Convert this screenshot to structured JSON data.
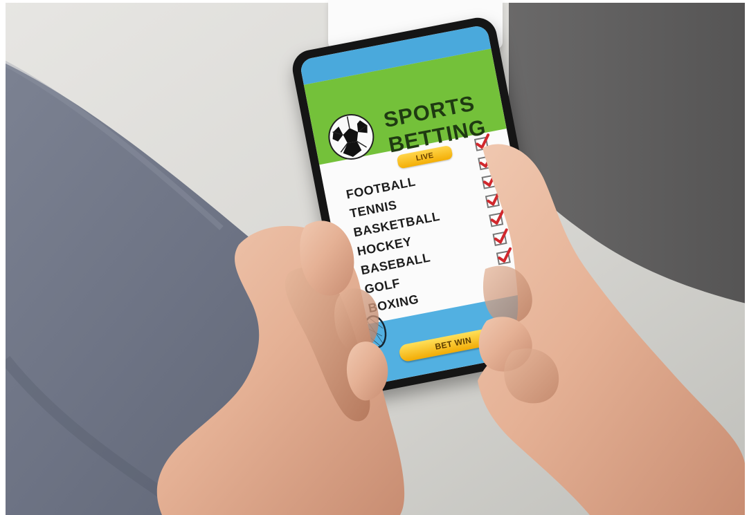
{
  "app": {
    "title_line_1": "SPORTS",
    "title_line_2": "BETTING",
    "live_label": "LIVE",
    "sports": [
      "FOOTBALL",
      "TENNIS",
      "BASKETBALL",
      "HOCKEY",
      "BASEBALL",
      "GOLF",
      "BOXING"
    ],
    "checked_count": 7,
    "bet_button_label": "BET WIN"
  },
  "icons": {
    "ball": "soccer-ball-icon",
    "check": "checkmark-icon",
    "racket": "tennis-racket-icon"
  },
  "colors": {
    "header_green": "#74c13a",
    "screen_blue": "#4aa9dc",
    "button_yellow": "#f2ab05",
    "check_red": "#d1282d"
  }
}
